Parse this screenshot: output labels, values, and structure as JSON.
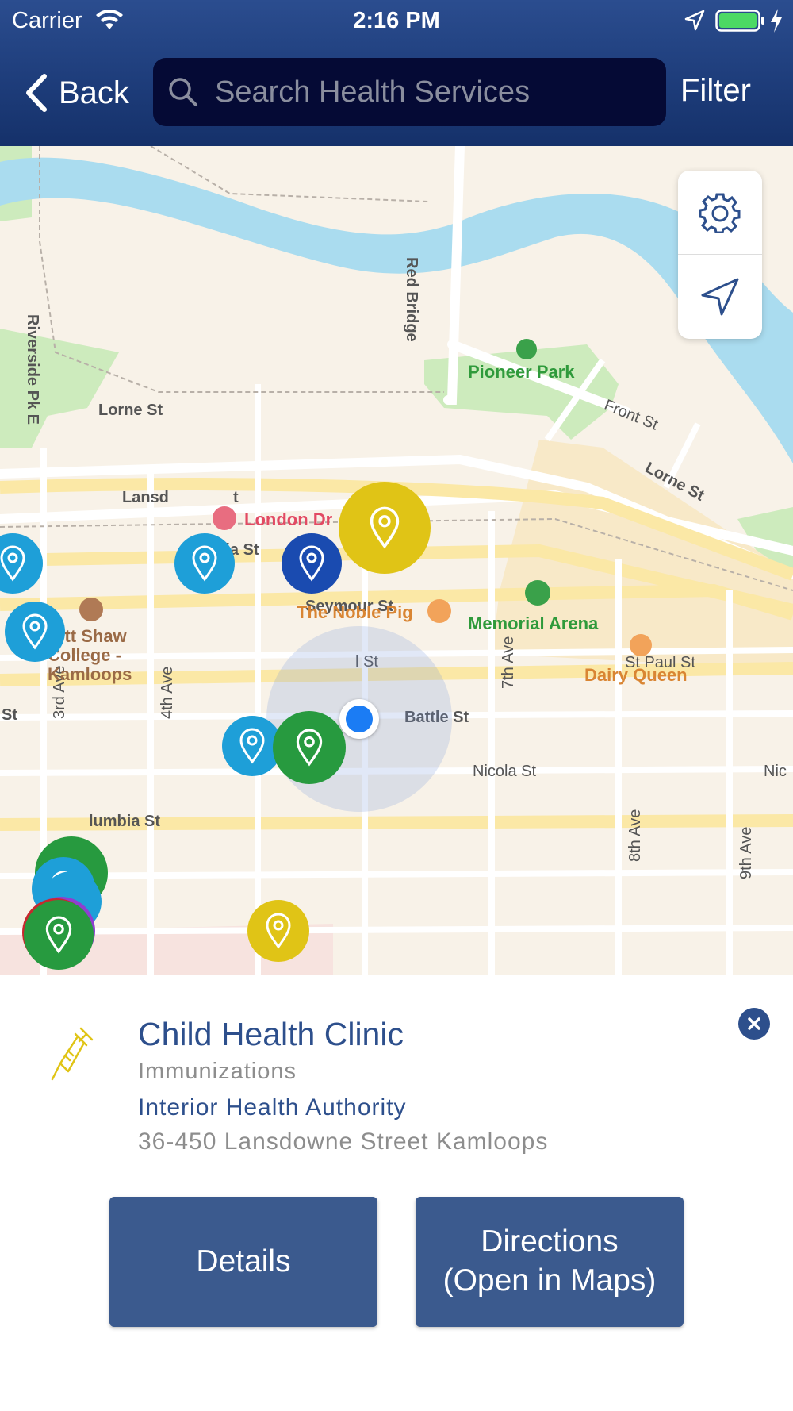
{
  "status_bar": {
    "carrier": "Carrier",
    "time": "2:16 PM"
  },
  "nav": {
    "back_label": "Back",
    "search_placeholder": "Search Health Services",
    "filter_label": "Filter"
  },
  "map": {
    "street_labels": {
      "red_bridge": "Red Bridge",
      "riverside": "Riverside Pk E",
      "lorne_west": "Lorne St",
      "lorne_east": "Lorne St",
      "front": "Front St",
      "lansdowne": "Lansd",
      "lansdowne_end": "t",
      "victoria": "Victoria St",
      "seymour": "Seymour St",
      "st_paul_partial": "l St",
      "st_paul": "St Paul St",
      "battle": "Battle St",
      "nicola": "Nicola St",
      "nicola_partial": "Nic",
      "columbia": "lumbia St",
      "st_left": "St",
      "ave_3": "3rd Ave",
      "ave_4": "4th Ave",
      "ave_7": "7th Ave",
      "ave_8": "8th Ave",
      "ave_9": "9th Ave"
    },
    "pois": {
      "pioneer_park": "Pioneer Park",
      "london_drugs": "London Dr",
      "noble_pig": "The Noble Pig",
      "memorial_arena": "Memorial Arena",
      "dairy_queen": "Dairy Queen",
      "college_line1": "ott Shaw",
      "college_line2": "College -",
      "college_line3": "Kamloops"
    },
    "controls": [
      "gear-icon",
      "navigation-arrow-icon"
    ],
    "marker_colors": {
      "light_blue": "#1e9fd8",
      "dark_blue": "#1a4bb0",
      "yellow": "#e0c416",
      "green": "#279a3f",
      "purple": "#8e3fd0",
      "red": "#c7282e"
    }
  },
  "selected_service": {
    "name": "Child Health Clinic",
    "category": "Immunizations",
    "authority": "Interior Health Authority",
    "address": "36-450 Lansdowne Street Kamloops",
    "icon": "syringe-icon"
  },
  "actions": {
    "details_label": "Details",
    "directions_line1": "Directions",
    "directions_line2": "(Open in Maps)"
  }
}
